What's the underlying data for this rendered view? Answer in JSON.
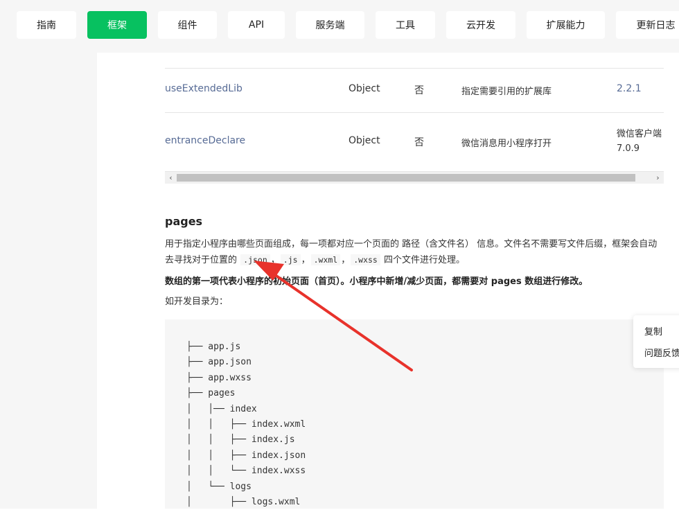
{
  "nav": {
    "items": [
      {
        "label": "指南",
        "active": false
      },
      {
        "label": "框架",
        "active": true
      },
      {
        "label": "组件",
        "active": false
      },
      {
        "label": "API",
        "active": false
      },
      {
        "label": "服务端",
        "active": false
      },
      {
        "label": "工具",
        "active": false
      },
      {
        "label": "云开发",
        "active": false
      },
      {
        "label": "扩展能力",
        "active": false
      },
      {
        "label": "更新日志",
        "active": false
      }
    ],
    "active_color": "#07c160"
  },
  "table": {
    "rows": [
      {
        "name": "useExtendedLib",
        "type": "Object",
        "required": "否",
        "description": "指定需要引用的扩展库",
        "version": "2.2.1"
      },
      {
        "name": "entranceDeclare",
        "type": "Object",
        "required": "否",
        "description": "微信消息用小程序打开",
        "version_line1": "微信客户端",
        "version_line2": "7.0.9"
      }
    ],
    "link_color": "#576b95"
  },
  "scrollbar": {
    "left_arrow": "‹",
    "right_arrow": "›"
  },
  "section": {
    "title": "pages",
    "para_part1": "用于指定小程序由哪些页面组成，每一项都对应一个页面的 路径（含文件名） 信息。文件名不需要写文件后缀，框架会自动去寻找对于位置的",
    "codes": [
      ".json",
      ".js",
      ".wxml",
      ".wxss"
    ],
    "sep": "，",
    "para_part2": "四个文件进行处理。",
    "bold_line": "数组的第一项代表小程序的初始页面（首页）。小程序中新增/减少页面，都需要对 pages 数组进行修改。",
    "dir_label": "如开发目录为："
  },
  "code_block": {
    "lines": [
      "├── app.js",
      "├── app.json",
      "├── app.wxss",
      "├── pages",
      "│   │── index",
      "│   │   ├── index.wxml",
      "│   │   ├── index.js",
      "│   │   ├── index.json",
      "│   │   └── index.wxss",
      "│   └── logs",
      "│       ├── logs.wxml"
    ]
  },
  "float_menu": {
    "copy": "复制",
    "feedback": "问题反馈"
  },
  "annotation": {
    "arrow_color": "#e8322b",
    "arrow_icon": "red-arrow-icon"
  }
}
